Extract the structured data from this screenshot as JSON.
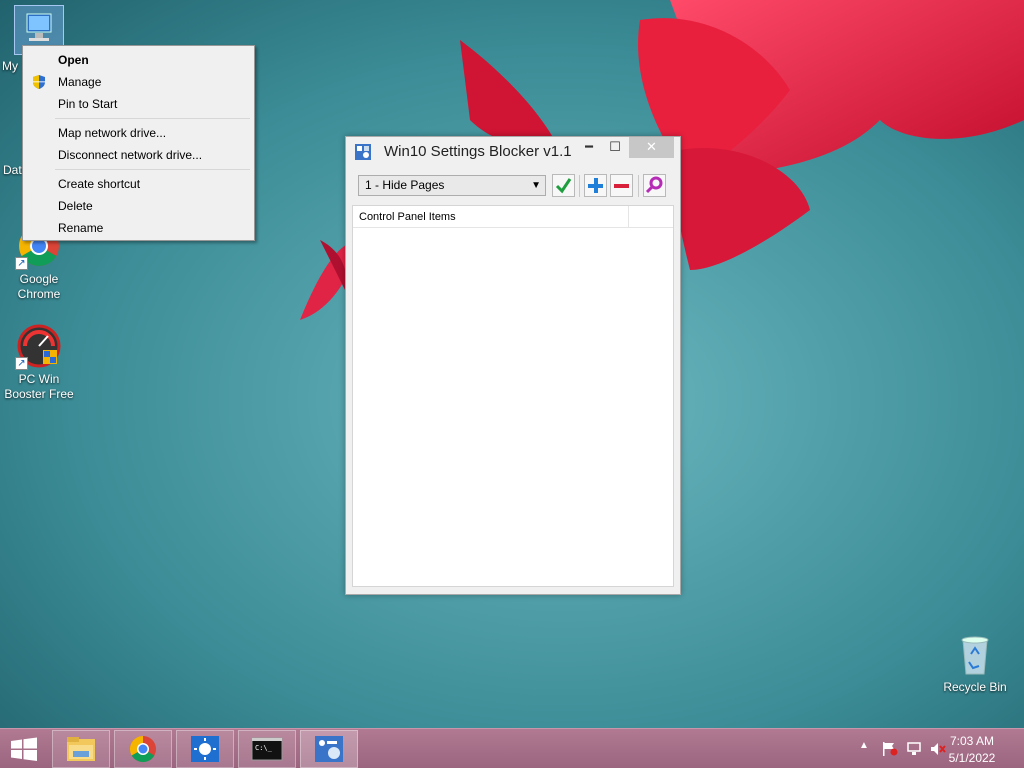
{
  "desktop": {
    "icons": [
      {
        "label": "My",
        "name": "my-computer"
      },
      {
        "label": "Dat",
        "name": "data"
      },
      {
        "label": "Google Chrome",
        "name": "google-chrome"
      },
      {
        "label": "PC Win Booster Free",
        "name": "pc-win-booster"
      },
      {
        "label": "Recycle Bin",
        "name": "recycle-bin"
      }
    ]
  },
  "context_menu": {
    "items": [
      {
        "label": "Open"
      },
      {
        "label": "Manage"
      },
      {
        "label": "Pin to Start"
      },
      {
        "label": "Map network drive..."
      },
      {
        "label": "Disconnect network drive..."
      },
      {
        "label": "Create shortcut"
      },
      {
        "label": "Delete"
      },
      {
        "label": "Rename"
      }
    ]
  },
  "window": {
    "title": "Win10 Settings Blocker v1.1",
    "close_glyph": "✕",
    "min_glyph": "━",
    "max_glyph": "☐",
    "select_value": "1 - Hide Pages",
    "columns": [
      "Control Panel Items"
    ]
  },
  "taskbar": {
    "time": "7:03 AM",
    "date": "5/1/2022"
  }
}
